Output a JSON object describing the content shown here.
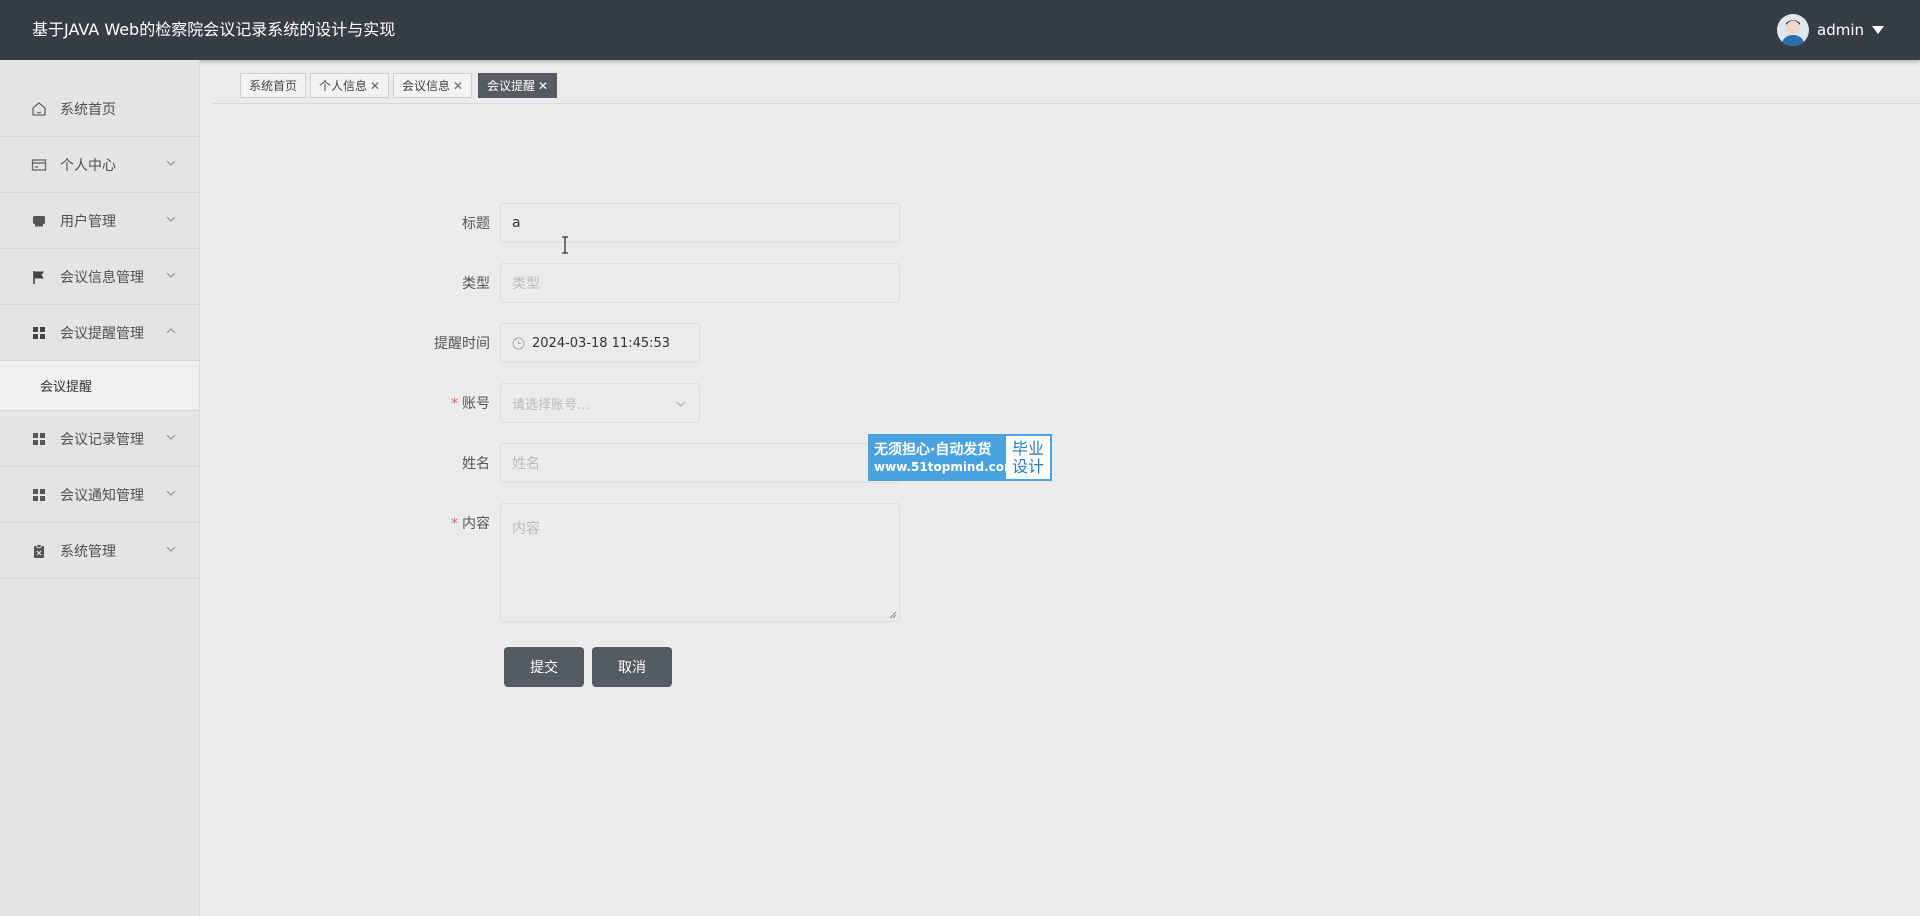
{
  "header": {
    "title": "基于JAVA Web的检察院会议记录系统的设计与实现",
    "username": "admin"
  },
  "sidebar": {
    "items": [
      {
        "label": "系统首页",
        "icon": "home-icon",
        "expandable": false
      },
      {
        "label": "个人中心",
        "icon": "id-card-icon",
        "expandable": true,
        "expanded": false
      },
      {
        "label": "用户管理",
        "icon": "user-manage-icon",
        "expandable": true,
        "expanded": false
      },
      {
        "label": "会议信息管理",
        "icon": "flag-icon",
        "expandable": true,
        "expanded": false
      },
      {
        "label": "会议提醒管理",
        "icon": "grid-icon",
        "expandable": true,
        "expanded": true
      },
      {
        "label": "会议记录管理",
        "icon": "grid-icon",
        "expandable": true,
        "expanded": false
      },
      {
        "label": "会议通知管理",
        "icon": "grid-icon",
        "expandable": true,
        "expanded": false
      },
      {
        "label": "系统管理",
        "icon": "clipboard-icon",
        "expandable": true,
        "expanded": false
      }
    ],
    "subitem": "会议提醒"
  },
  "tabs": [
    {
      "label": "系统首页",
      "closable": false,
      "active": false
    },
    {
      "label": "个人信息",
      "closable": true,
      "active": false
    },
    {
      "label": "会议信息",
      "closable": true,
      "active": false
    },
    {
      "label": "会议提醒",
      "closable": true,
      "active": true
    }
  ],
  "tab_close_glyph": "✕",
  "form": {
    "title": {
      "label": "标题",
      "value": "a"
    },
    "type": {
      "label": "类型",
      "placeholder": "类型"
    },
    "remind_time": {
      "label": "提醒时间",
      "value": "2024-03-18 11:45:53"
    },
    "account": {
      "label": "账号",
      "placeholder": "请选择账号...",
      "required": true
    },
    "name": {
      "label": "姓名",
      "placeholder": "姓名"
    },
    "content": {
      "label": "内容",
      "placeholder": "内容",
      "required": true
    },
    "required_mark": "*",
    "submit_label": "提交",
    "cancel_label": "取消"
  },
  "watermark": {
    "line1": "无须担心·自动发货",
    "line2": "www.51topmind.com",
    "right1": "毕业",
    "right2": "设计"
  },
  "colors": {
    "header_bg": "#373d46",
    "sidebar_bg": "#e4e4e4",
    "button_bg": "#555b63",
    "required": "#e05c5c",
    "watermark": "#4aa3df"
  }
}
